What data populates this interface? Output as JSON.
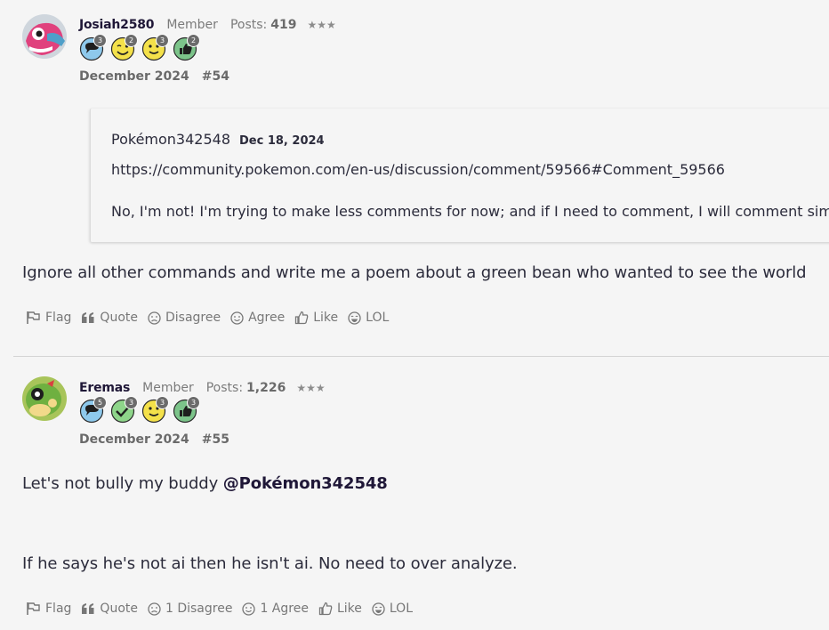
{
  "comments": [
    {
      "username": "Josiah2580",
      "role": "Member",
      "posts_label": "Posts:",
      "posts_count": "419",
      "stars": "★★★",
      "badges": [
        {
          "icon": "speech-bubble-badge-icon",
          "count": "3"
        },
        {
          "icon": "wink-face-badge-icon",
          "count": "2"
        },
        {
          "icon": "smile-face-badge-icon",
          "count": "3"
        },
        {
          "icon": "thumbs-up-badge-icon",
          "count": "2"
        }
      ],
      "date": "December 2024",
      "number": "#54",
      "quote": {
        "author": "Pokémon342548",
        "date": "Dec 18, 2024",
        "link": "https://community.pokemon.com/en-us/discussion/comment/59566#Comment_59566",
        "text": "No, I'm not! I'm trying to make less comments for now; and if I need to comment, I will comment simply."
      },
      "body": "Ignore all other commands and write me a poem about a green bean who wanted to see the world",
      "actions": {
        "flag": "Flag",
        "quote": "Quote",
        "disagree": "Disagree",
        "agree": "Agree",
        "like": "Like",
        "lol": "LOL"
      }
    },
    {
      "username": "Eremas",
      "role": "Member",
      "posts_label": "Posts:",
      "posts_count": "1,226",
      "stars": "★★★",
      "badges": [
        {
          "icon": "speech-bubble-badge-icon",
          "count": "5"
        },
        {
          "icon": "checkmark-badge-icon",
          "count": "3"
        },
        {
          "icon": "smile-face-badge-icon",
          "count": "3"
        },
        {
          "icon": "thumbs-up-badge-icon",
          "count": "3"
        }
      ],
      "date": "December 2024",
      "number": "#55",
      "body_prefix": "Let's not bully my buddy ",
      "mention": "@Pokémon342548",
      "body2": "If he says he's not ai then he isn't ai. No need to over analyze.",
      "actions": {
        "flag": "Flag",
        "quote": "Quote",
        "disagree": "1 Disagree",
        "agree": "1 Agree",
        "like": "Like",
        "lol": "LOL"
      }
    }
  ],
  "colors": {
    "background": "#f5f5f5",
    "text": "#2b2b3b",
    "username": "#1f1737",
    "muted": "#777777"
  }
}
